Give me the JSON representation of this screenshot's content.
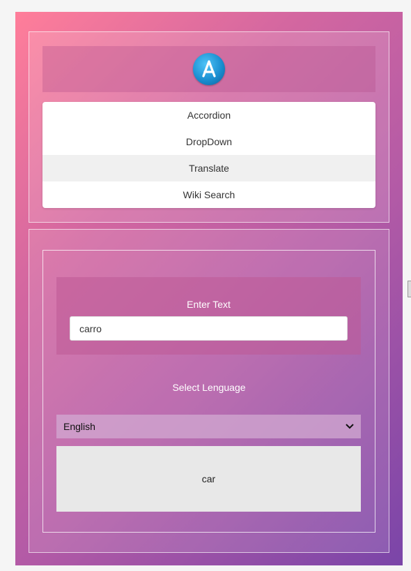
{
  "menu": {
    "items": [
      {
        "label": "Accordion"
      },
      {
        "label": "DropDown"
      },
      {
        "label": "Translate"
      },
      {
        "label": "Wiki Search"
      }
    ],
    "active_index": 2
  },
  "translate": {
    "input_label": "Enter Text",
    "input_value": "carro",
    "select_label": "Select Lenguage",
    "selected_language": "English",
    "output": "car"
  },
  "icons": {
    "logo": "app-store-icon",
    "select_arrow": "chevron-down-icon"
  },
  "colors": {
    "gradient_start": "#ff7e9a",
    "gradient_end": "#7a45a8",
    "output_background": "#e8e8e8"
  }
}
